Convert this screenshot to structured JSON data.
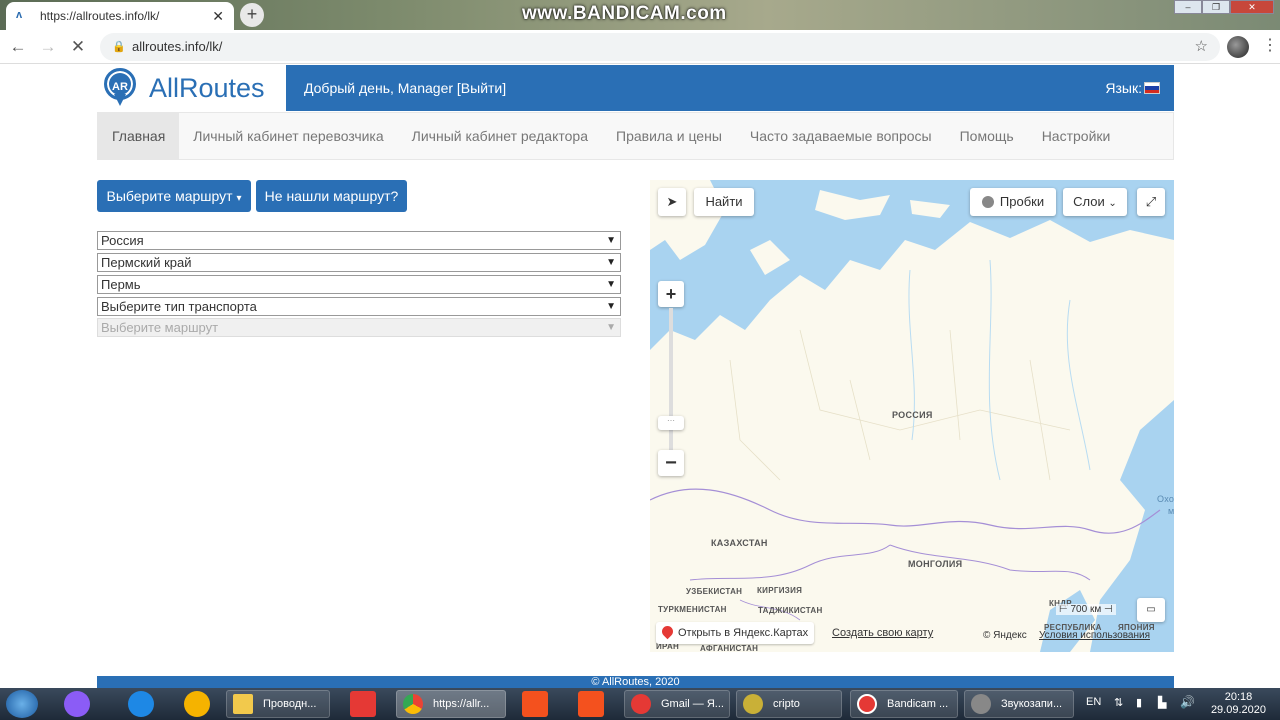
{
  "browser": {
    "tab_title": "https://allroutes.info/lk/",
    "url": "allroutes.info/lk/",
    "watermark": "www.BANDICAM.com"
  },
  "header": {
    "logo_badge": "AR",
    "logo_text": "AllRoutes",
    "greeting": "Добрый день, Manager [Выйти]",
    "language_label": "Язык:"
  },
  "menu": [
    {
      "label": "Главная",
      "active": true
    },
    {
      "label": "Личный кабинет перевозчика"
    },
    {
      "label": "Личный кабинет редактора"
    },
    {
      "label": "Правила и цены"
    },
    {
      "label": "Часто задаваемые вопросы"
    },
    {
      "label": "Помощь"
    },
    {
      "label": "Настройки"
    }
  ],
  "actions": {
    "choose_route": "Выберите маршрут",
    "not_found": "Не нашли маршрут?"
  },
  "selects": {
    "country": "Россия",
    "region": "Пермский край",
    "city": "Пермь",
    "transport": "Выберите тип транспорта",
    "route": "Выберите маршрут"
  },
  "map": {
    "find": "Найти",
    "traffic": "Пробки",
    "layers": "Слои",
    "scale": "700 км",
    "open_yandex": "Открыть в Яндекс.Картах",
    "create_map": "Создать свою карту",
    "copyright": "© Яндекс",
    "terms": "Условия использования",
    "labels": {
      "russia": "РОССИЯ",
      "kazakhstan": "КАЗАХСТАН",
      "mongolia": "МОНГОЛИЯ",
      "uzbekistan": "УЗБЕКИСТАН",
      "kyrgyzstan": "КИРГИЗИЯ",
      "turkmenistan": "ТУРКМЕНИСТАН",
      "tajikistan": "ТАДЖИКИСТАН",
      "iran": "ИРАН",
      "afghanistan": "АФГАНИСТАН",
      "dprk": "КНДР",
      "republic": "РЕСПУБЛИКА",
      "japan": "ЯПОНИЯ",
      "ocean": "Охо",
      "ocean2": "м"
    }
  },
  "footer": {
    "text": "© AllRoutes, 2020"
  },
  "taskbar": {
    "items": [
      "Проводн...",
      "https://allr...",
      "Gmail — Я...",
      "cripto",
      "Bandicam ...",
      "Звукозапи..."
    ],
    "lang": "EN",
    "time": "20:18",
    "date": "29.09.2020"
  }
}
